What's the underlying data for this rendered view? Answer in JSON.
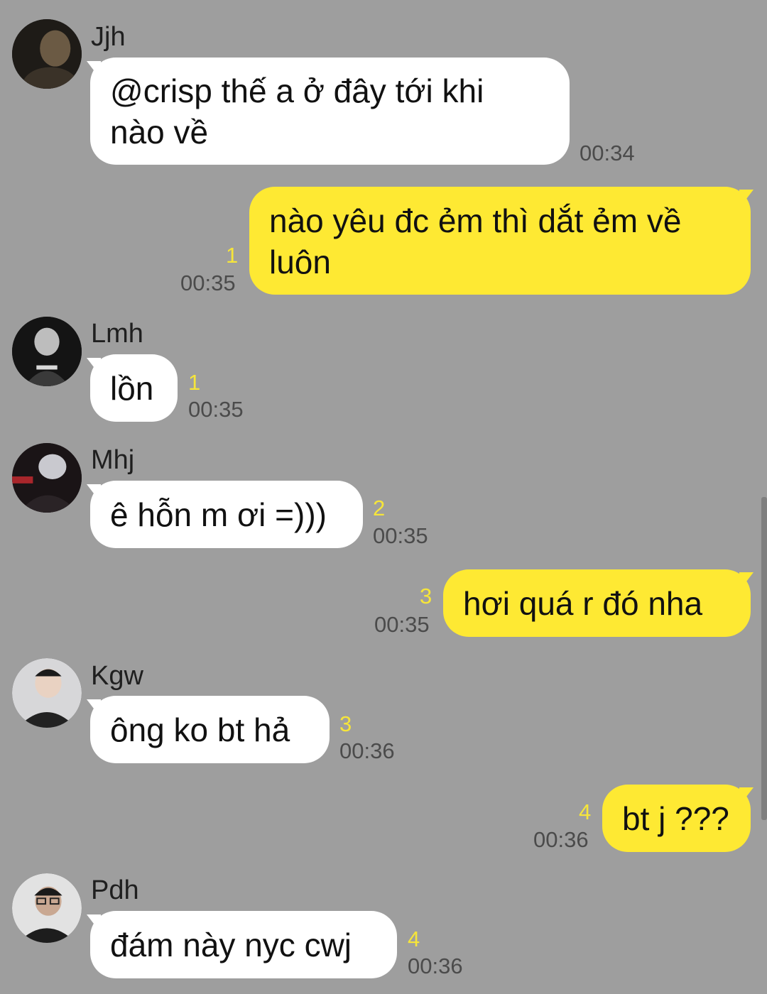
{
  "messages": [
    {
      "sender": "Jjh",
      "avatar": "avatar-photo-icon",
      "lines": [
        "@crisp thế a ở đây tới khi",
        "nào về"
      ],
      "time": "00:34",
      "unread": ""
    },
    {
      "sender": "",
      "lines": [
        "nào yêu đc ẻm thì dắt ẻm về",
        "luôn"
      ],
      "time": "00:35",
      "unread": "1"
    },
    {
      "sender": "Lmh",
      "avatar": "avatar-photo-icon",
      "lines": [
        "lồn"
      ],
      "time": "00:35",
      "unread": "1"
    },
    {
      "sender": "Mhj",
      "avatar": "avatar-photo-icon",
      "lines": [
        "ê hỗn m ơi =)))"
      ],
      "time": "00:35",
      "unread": "2"
    },
    {
      "sender": "",
      "lines": [
        "hơi quá r đó nha"
      ],
      "time": "00:35",
      "unread": "3"
    },
    {
      "sender": "Kgw",
      "avatar": "avatar-photo-icon",
      "lines": [
        "ông ko bt hả"
      ],
      "time": "00:36",
      "unread": "3"
    },
    {
      "sender": "",
      "lines": [
        "bt j ???"
      ],
      "time": "00:36",
      "unread": "4"
    },
    {
      "sender": "Pdh",
      "avatar": "avatar-photo-icon",
      "lines": [
        "đám này nyc cwj"
      ],
      "time": "00:36",
      "unread": "4"
    }
  ],
  "colors": {
    "background": "#9e9e9e",
    "incoming": "#ffffff",
    "outgoing": "#fee933",
    "unread": "#f6e53a"
  }
}
